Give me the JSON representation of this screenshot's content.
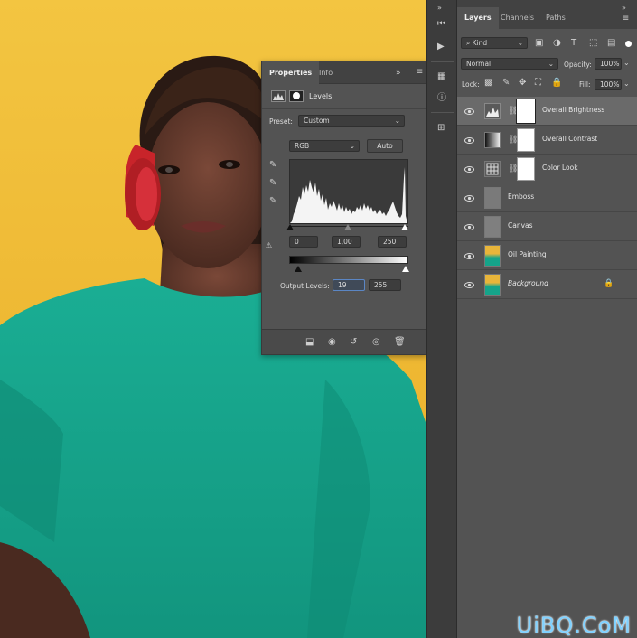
{
  "properties": {
    "tabs": [
      "Properties",
      "Info"
    ],
    "adjustment_title": "Levels",
    "preset_label": "Preset:",
    "preset_value": "Custom",
    "channel_value": "RGB",
    "auto_label": "Auto",
    "input_black": "0",
    "input_gamma": "1,00",
    "input_white": "250",
    "output_label": "Output Levels:",
    "output_black": "19",
    "output_white": "255"
  },
  "layers_panel": {
    "tabs": [
      "Layers",
      "Channels",
      "Paths"
    ],
    "filter_value": "Kind",
    "blend_mode": "Normal",
    "opacity_label": "Opacity:",
    "opacity_value": "100%",
    "lock_label": "Lock:",
    "fill_label": "Fill:",
    "fill_value": "100%",
    "layers": [
      {
        "name": "Overall Brightness",
        "type": "levels",
        "selected": true
      },
      {
        "name": "Overall Contrast",
        "type": "gradient-map",
        "selected": false
      },
      {
        "name": "Color Look",
        "type": "lookup",
        "selected": false
      },
      {
        "name": "Emboss",
        "type": "gray",
        "selected": false
      },
      {
        "name": "Canvas",
        "type": "gray",
        "selected": false
      },
      {
        "name": "Oil Painting",
        "type": "photo",
        "selected": false
      },
      {
        "name": "Background",
        "type": "photo",
        "selected": false,
        "locked": true
      }
    ]
  },
  "watermark": "UiBQ.CoM",
  "colors": {
    "background_yellow": "#f0bd38",
    "dress_teal": "#14a88e",
    "skin": "#5a3428",
    "headphone_red": "#c8242a",
    "panel_gray": "#535353"
  }
}
